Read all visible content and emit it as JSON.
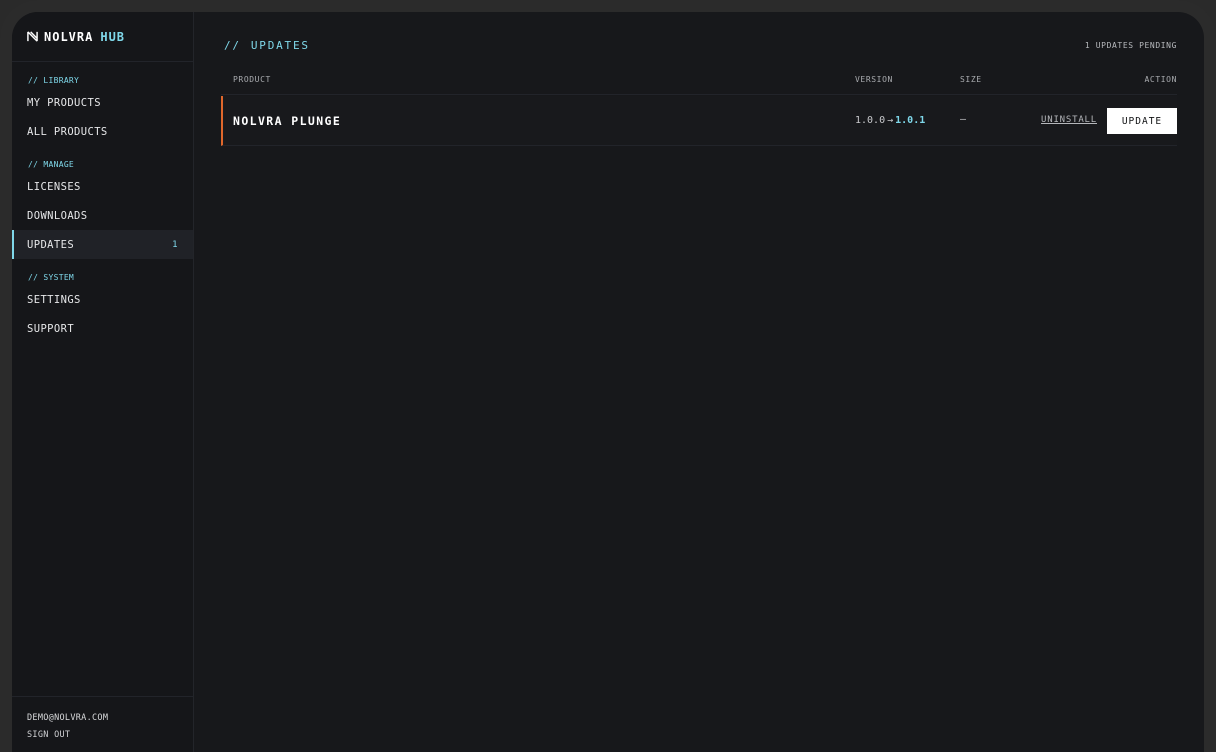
{
  "brand": {
    "name": "NOLVRA",
    "suffix": "HUB"
  },
  "sidebar": {
    "sections": [
      {
        "label": "// LIBRARY",
        "items": [
          {
            "label": "MY PRODUCTS"
          },
          {
            "label": "ALL PRODUCTS"
          }
        ]
      },
      {
        "label": "// MANAGE",
        "items": [
          {
            "label": "LICENSES"
          },
          {
            "label": "DOWNLOADS"
          },
          {
            "label": "UPDATES",
            "badge": "1",
            "active": true
          }
        ]
      },
      {
        "label": "// SYSTEM",
        "items": [
          {
            "label": "SETTINGS"
          },
          {
            "label": "SUPPORT"
          }
        ]
      }
    ],
    "footer": {
      "email": "DEMO@NOLVRA.COM",
      "signout": "SIGN OUT"
    }
  },
  "main": {
    "title_prefix": "//",
    "title": "UPDATES",
    "pending": "1 UPDATES PENDING",
    "table": {
      "columns": {
        "product": "PRODUCT",
        "version": "VERSION",
        "size": "SIZE",
        "action": "ACTION"
      },
      "rows": [
        {
          "product": "NOLVRA PLUNGE",
          "version_from": "1.0.0",
          "version_arrow": "→",
          "version_to": "1.0.1",
          "size": "—",
          "uninstall": "UNINSTALL",
          "update": "UPDATE"
        }
      ]
    }
  },
  "colors": {
    "accent": "#7fd8ea",
    "row_marker": "#e0672b",
    "background": "#17181b"
  }
}
